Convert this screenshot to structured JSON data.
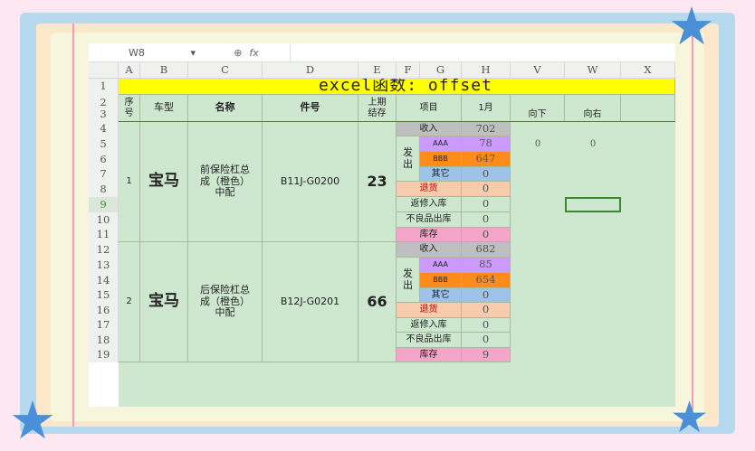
{
  "decor": {
    "star_color": "#4a90d9"
  },
  "formula_bar": {
    "name_box": "W8",
    "fx_label": "fx"
  },
  "columns": [
    "A",
    "B",
    "C",
    "D",
    "E",
    "F",
    "G",
    "H",
    "V",
    "W",
    "X"
  ],
  "rows": [
    "1",
    "2\n3",
    "4",
    "5",
    "6",
    "7",
    "8",
    "9",
    "10",
    "11",
    "12",
    "13",
    "14",
    "15",
    "16",
    "17",
    "18",
    "19"
  ],
  "title": "excel函数: offset",
  "headers": {
    "seq": "序\n号",
    "car_type": "车型",
    "name": "名称",
    "part_no": "件号",
    "prev_stock": "上期\n结存",
    "item": "项目",
    "month": "1月",
    "down": "向下",
    "right": "向右"
  },
  "records": [
    {
      "seq": "1",
      "car_type": "宝马",
      "name": "前保险杠总\n成（橙色）\n中配",
      "part_no": "B11J-G0200",
      "prev_stock": "23",
      "issue_label": "发\n出",
      "lines": [
        {
          "label": "收入",
          "value": "702"
        },
        {
          "label": "AAA",
          "value": "78"
        },
        {
          "label": "BBB",
          "value": "647"
        },
        {
          "label": "其它",
          "value": "0"
        },
        {
          "label": "退货",
          "value": "0"
        },
        {
          "label": "返修入库",
          "value": "0"
        },
        {
          "label": "不良品出库",
          "value": "0"
        },
        {
          "label": "库存",
          "value": "0"
        }
      ]
    },
    {
      "seq": "2",
      "car_type": "宝马",
      "name": "后保险杠总\n成（橙色）\n中配",
      "part_no": "B12J-G0201",
      "prev_stock": "66",
      "issue_label": "发\n出",
      "lines": [
        {
          "label": "收入",
          "value": "682"
        },
        {
          "label": "AAA",
          "value": "85"
        },
        {
          "label": "BBB",
          "value": "654"
        },
        {
          "label": "其它",
          "value": "0"
        },
        {
          "label": "退货",
          "value": "0"
        },
        {
          "label": "返修入库",
          "value": "0"
        },
        {
          "label": "不良品出库",
          "value": "0"
        },
        {
          "label": "库存",
          "value": "9"
        }
      ]
    }
  ],
  "offset_results": {
    "down": "0",
    "right": "0"
  },
  "colors": {
    "title_bg": "#ffff00",
    "sheet_green": "#cde8cf",
    "income": "#bfbfbf",
    "aaa": "#cc99ff",
    "bbb": "#ff8c1a",
    "other": "#9dc3e6",
    "return": "#f8cbad",
    "stock": "#f4a6c8",
    "selection": "#3c8a2e"
  }
}
